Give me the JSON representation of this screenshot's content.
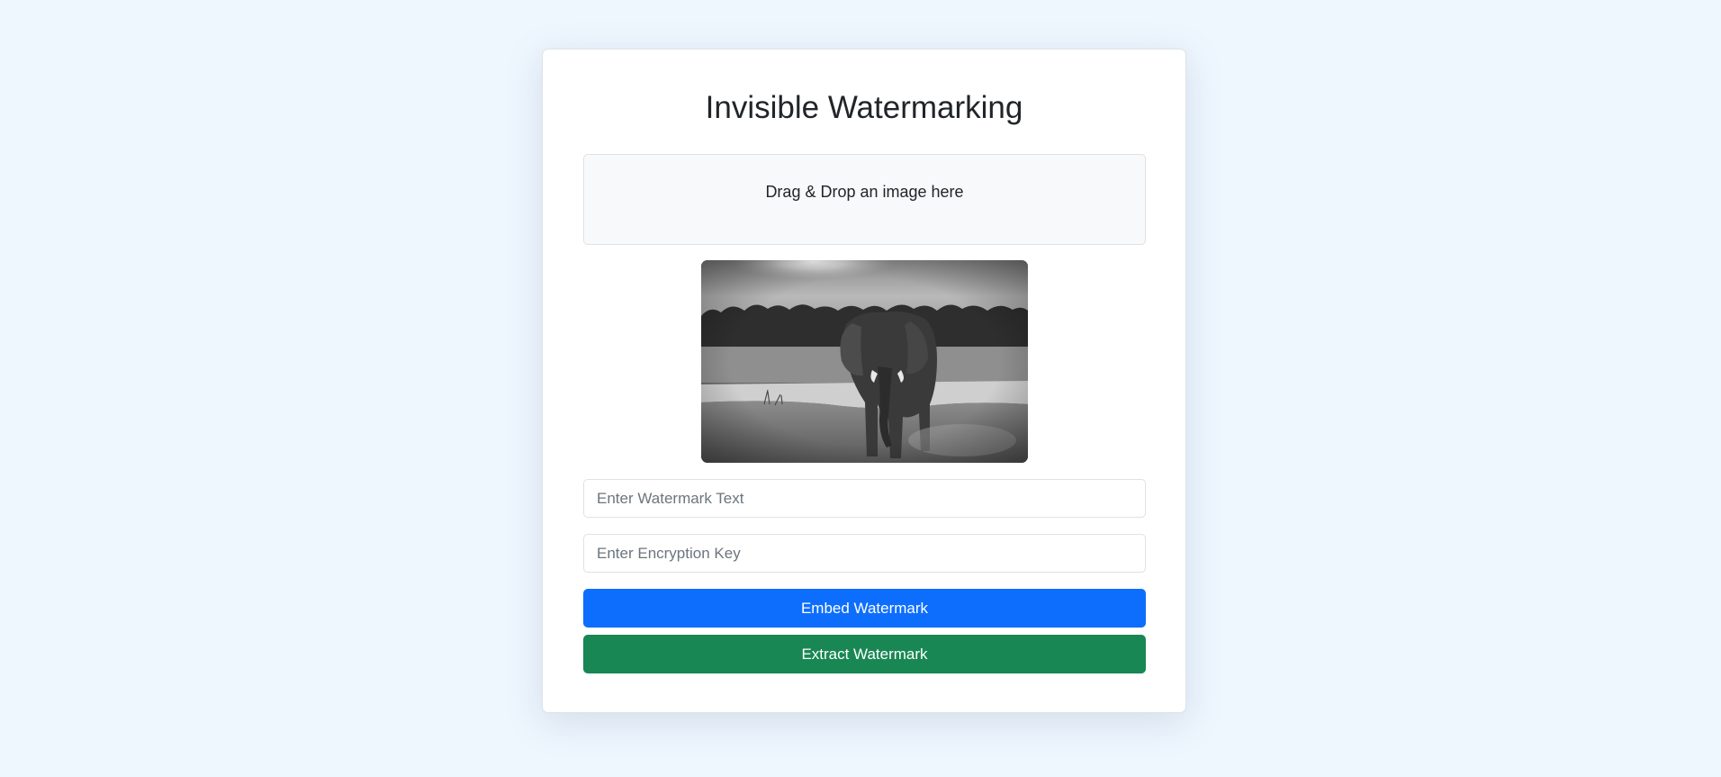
{
  "page": {
    "title": "Invisible Watermarking"
  },
  "dropzone": {
    "label": "Drag & Drop an image here"
  },
  "preview": {
    "description": "grayscale elephant standing by a river"
  },
  "inputs": {
    "watermark_text": {
      "value": "",
      "placeholder": "Enter Watermark Text"
    },
    "encryption_key": {
      "value": "",
      "placeholder": "Enter Encryption Key"
    }
  },
  "buttons": {
    "embed_label": "Embed Watermark",
    "extract_label": "Extract Watermark"
  },
  "colors": {
    "background": "#eef6fe",
    "embed_button": "#0d6efd",
    "extract_button": "#198754"
  }
}
